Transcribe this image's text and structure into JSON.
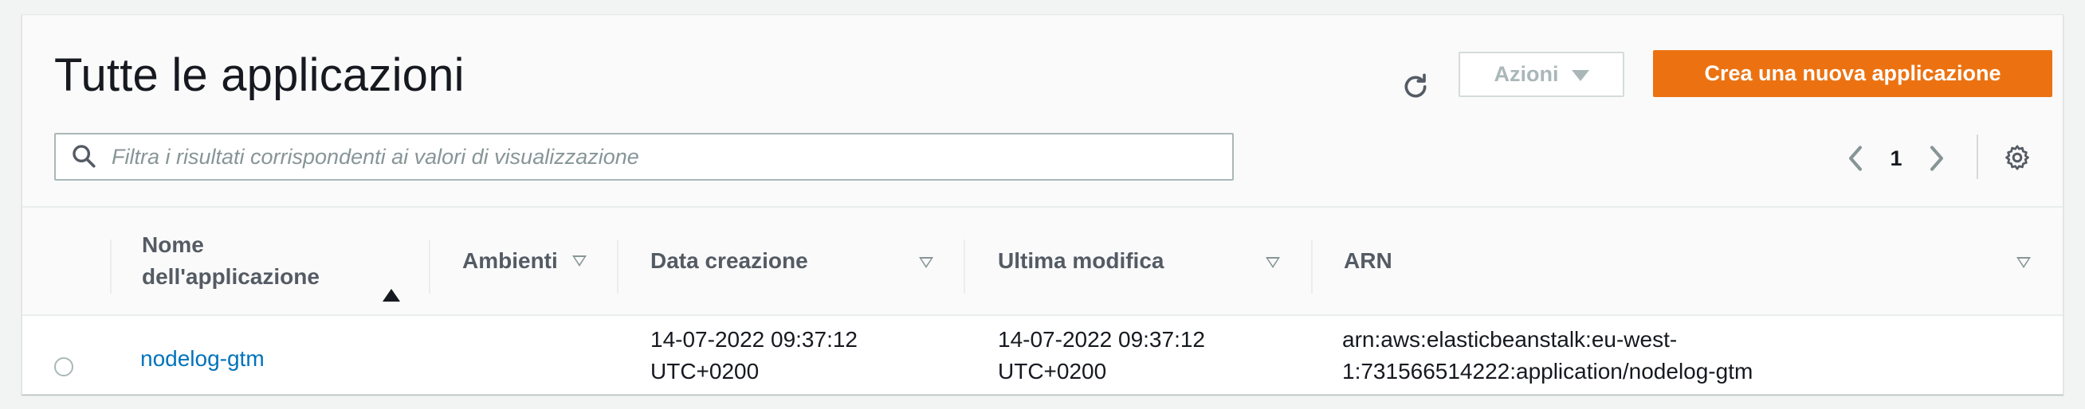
{
  "page": {
    "title": "Tutte le applicazioni"
  },
  "toolbar": {
    "refresh_icon": "refresh-icon",
    "actions_label": "Azioni",
    "create_label": "Crea una nuova applicazione",
    "accent_color": "#ec7211"
  },
  "search": {
    "placeholder": "Filtra i risultati corrispondenti ai valori di visualizzazione",
    "value": ""
  },
  "pagination": {
    "current_page": "1"
  },
  "table": {
    "columns": [
      {
        "line1": "Nome",
        "line2": "dell'applicazione",
        "sort": "ascending"
      },
      {
        "label": "Ambienti",
        "sort": "none"
      },
      {
        "label": "Data creazione",
        "sort": "none"
      },
      {
        "label": "Ultima modifica",
        "sort": "none"
      },
      {
        "label": "ARN",
        "sort": "none"
      }
    ],
    "rows": [
      {
        "selected": false,
        "name": "nodelog-gtm",
        "environments": "",
        "created_line1": "14-07-2022 09:37:12",
        "created_line2": "UTC+0200",
        "modified_line1": "14-07-2022 09:37:12",
        "modified_line2": "UTC+0200",
        "arn_line1": "arn:aws:elasticbeanstalk:eu-west-",
        "arn_line2": "1:731566514222:application/nodelog-gtm"
      }
    ]
  }
}
